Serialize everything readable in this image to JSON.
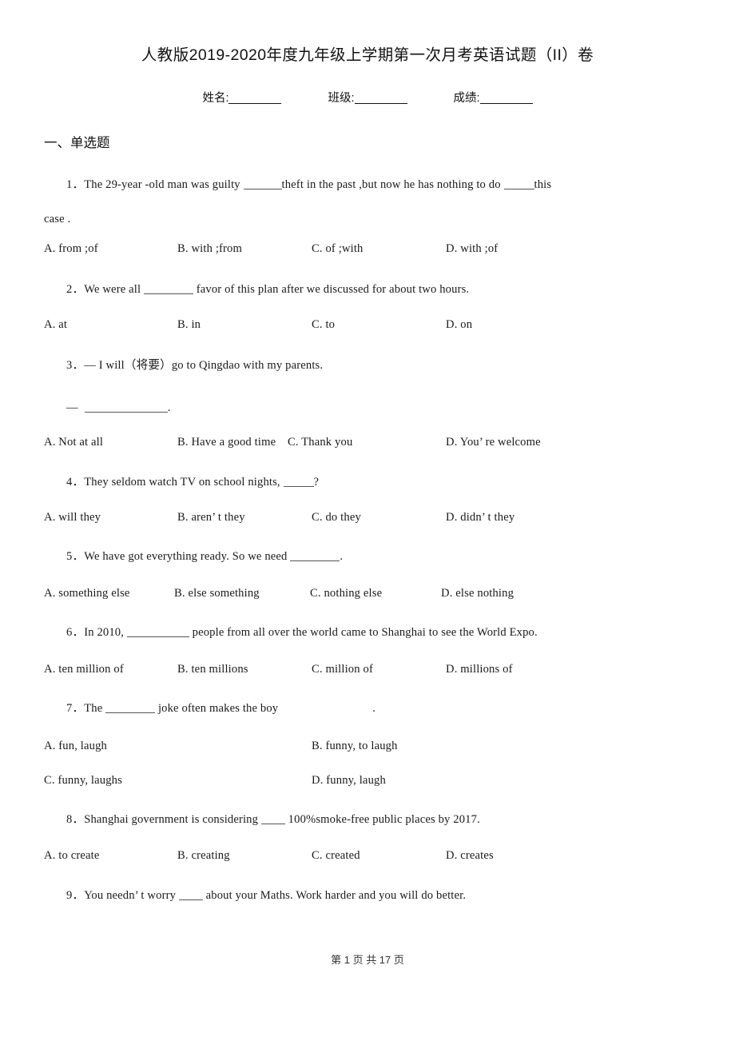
{
  "document": {
    "title": "人教版2019-2020年度九年级上学期第一次月考英语试题（II）卷",
    "identity": {
      "name_label": "姓名:",
      "class_label": "班级:",
      "score_label": "成绩:"
    },
    "footer": "第 1 页 共 17 页"
  },
  "sections": [
    {
      "heading": "一、单选题"
    }
  ],
  "questions": [
    {
      "number": "1",
      "line1_a": "1．The 29-year -old man was guilty ",
      "line1_b": "theft in the past ,but now he has nothing to do ",
      "line1_c": "this",
      "line2": "case .",
      "options": [
        "A. from ;of",
        "B. with ;from",
        "C. of ;with",
        "D. with ;of"
      ]
    },
    {
      "number": "2",
      "text_a": "2．We were all ",
      "text_b": " favor of this plan after we discussed for about two hours.",
      "options": [
        "A. at",
        "B. in",
        "C. to",
        "D. on"
      ]
    },
    {
      "number": "3",
      "dialog_1": "3．— I will（将要）go to Qingdao with my parents.",
      "dialog_2_prefix": "—",
      "dialog_2_suffix": ".",
      "options": [
        "A. Not at all",
        "B. Have a good time",
        "C. Thank you",
        "D. You’ re welcome"
      ]
    },
    {
      "number": "4",
      "text_a": "4．They seldom watch TV on school nights, ",
      "text_b": "?",
      "options": [
        "A. will they",
        "B. aren’ t they",
        "C. do they",
        "D. didn’ t they"
      ]
    },
    {
      "number": "5",
      "text_a": "5．We have got everything ready. So we need ",
      "text_b": ".",
      "options": [
        "A. something else",
        "B. else something",
        "C. nothing else",
        "D. else nothing"
      ]
    },
    {
      "number": "6",
      "text_a": "6．In 2010, ",
      "text_b": " people from all over the world came to Shanghai to see the World Expo.",
      "options": [
        "A. ten million of",
        "B. ten millions",
        "C. million of",
        "D. millions of"
      ]
    },
    {
      "number": "7",
      "text_a": "7．The ",
      "text_b": " joke often makes the boy",
      "text_c": ".",
      "options": [
        "A. fun, laugh",
        "B. funny, to laugh",
        "C. funny, laughs",
        "D. funny, laugh"
      ]
    },
    {
      "number": "8",
      "text_a": "8．Shanghai government is considering ",
      "text_b": " 100%smoke-free public places by 2017.",
      "options": [
        "A. to create",
        "B. creating",
        "C. created",
        "D. creates"
      ]
    },
    {
      "number": "9",
      "text_a": "9．You needn’ t worry ",
      "text_b": " about your Maths. Work harder and you will do better.",
      "options": []
    }
  ]
}
